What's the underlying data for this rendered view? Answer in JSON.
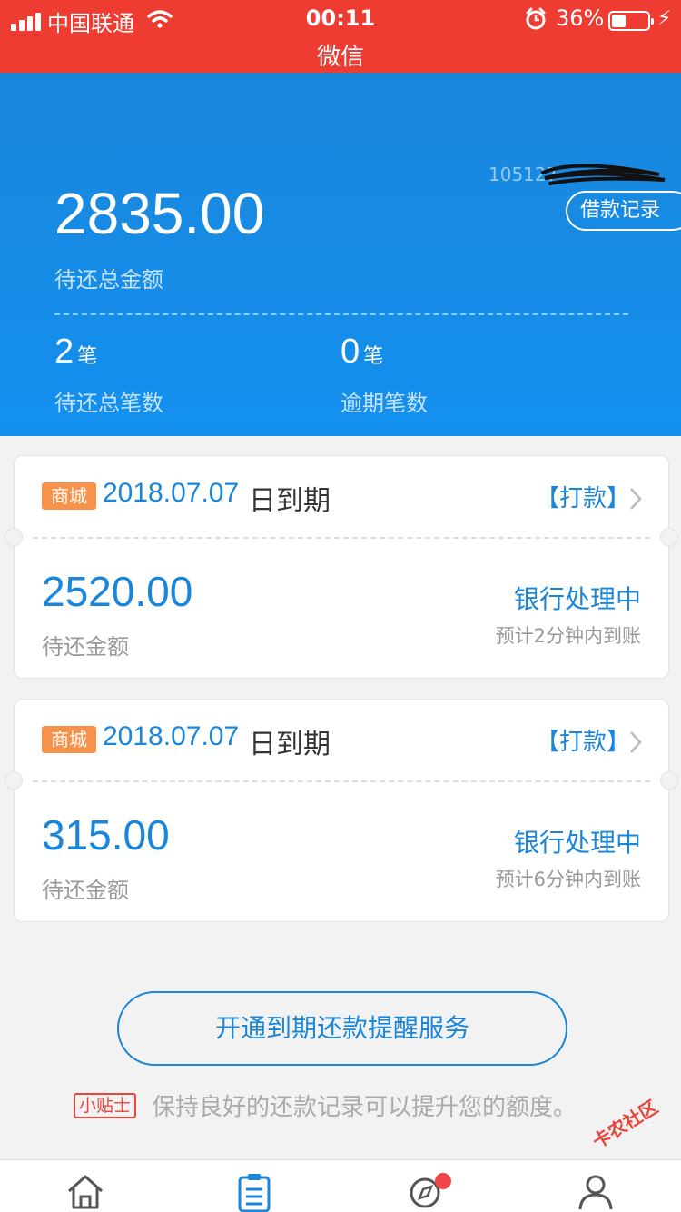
{
  "status_bar": {
    "carrier": "中国联通",
    "time": "00:11",
    "battery": "36%",
    "battery_level": 0.36
  },
  "app_title": "微信",
  "header": {
    "account_id": "105127",
    "records_button": "借款记录",
    "total_amount": "2835.00",
    "total_label": "待还总金额",
    "pending_count": "2",
    "pending_unit": "笔",
    "pending_label": "待还总笔数",
    "overdue_count": "0",
    "overdue_unit": "笔",
    "overdue_label": "逾期笔数"
  },
  "loans": [
    {
      "tag": "商城",
      "due_date": "2018.07.07",
      "due_suffix": "日到期",
      "action": "【打款】",
      "amount": "2520.00",
      "amount_label": "待还金额",
      "status": "银行处理中",
      "eta": "预计2分钟内到账"
    },
    {
      "tag": "商城",
      "due_date": "2018.07.07",
      "due_suffix": "日到期",
      "action": "【打款】",
      "amount": "315.00",
      "amount_label": "待还金额",
      "status": "银行处理中",
      "eta": "预计6分钟内到账"
    }
  ],
  "reminder_button": "开通到期还款提醒服务",
  "tip": {
    "tag": "小贴士",
    "text": "保持良好的还款记录可以提升您的额度。"
  },
  "tabbar": {
    "icons": [
      "home-icon",
      "orders-icon",
      "discover-icon",
      "profile-icon"
    ]
  },
  "watermark": "卡农社区",
  "colors": {
    "status_bar": "#ee3c33",
    "header_blue": "#1a86db",
    "tag_orange": "#f7924a",
    "tip_red": "#e8463b"
  }
}
